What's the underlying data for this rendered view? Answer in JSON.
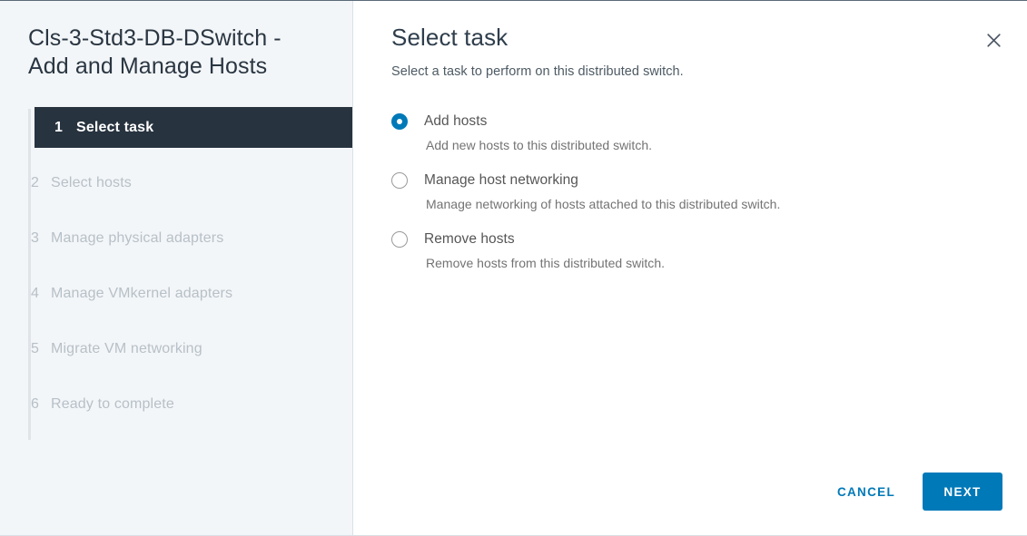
{
  "wizard": {
    "title": "Cls-3-Std3-DB-DSwitch -\nAdd and Manage Hosts",
    "steps": [
      {
        "num": "1",
        "label": "Select task"
      },
      {
        "num": "2",
        "label": "Select hosts"
      },
      {
        "num": "3",
        "label": "Manage physical adapters"
      },
      {
        "num": "4",
        "label": "Manage VMkernel adapters"
      },
      {
        "num": "5",
        "label": "Migrate VM networking"
      },
      {
        "num": "6",
        "label": "Ready to complete"
      }
    ]
  },
  "panel": {
    "title": "Select task",
    "subtitle": "Select a task to perform on this distributed switch.",
    "close_icon": "close-icon",
    "options": [
      {
        "label": "Add hosts",
        "description": "Add new hosts to this distributed switch.",
        "selected": true
      },
      {
        "label": "Manage host networking",
        "description": "Manage networking of hosts attached to this distributed switch.",
        "selected": false
      },
      {
        "label": "Remove hosts",
        "description": "Remove hosts from this distributed switch.",
        "selected": false
      }
    ]
  },
  "footer": {
    "cancel_label": "CANCEL",
    "next_label": "NEXT"
  },
  "colors": {
    "accent": "#0079b8",
    "active_step_bg": "#27333f",
    "sidebar_bg": "#f3f6f8"
  }
}
